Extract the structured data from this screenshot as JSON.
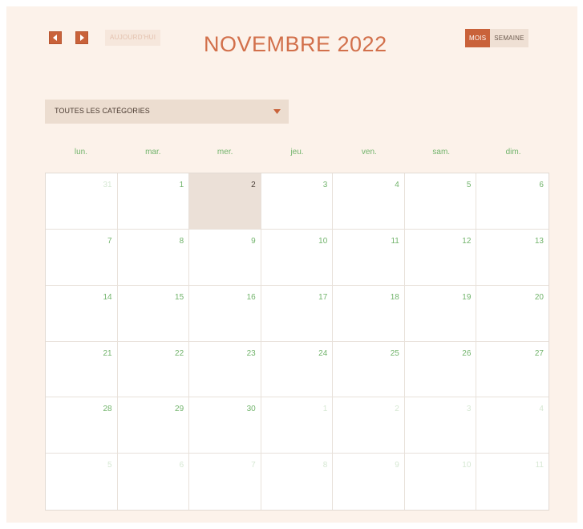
{
  "toolbar": {
    "today_label": "AUJOURD'HUI",
    "title": "NOVEMBRE 2022",
    "views": [
      {
        "label": "MOIS",
        "active": true
      },
      {
        "label": "SEMAINE",
        "active": false
      }
    ]
  },
  "filter": {
    "category_label": "TOUTES LES CATÉGORIES"
  },
  "weekdays": [
    "lun.",
    "mar.",
    "mer.",
    "jeu.",
    "ven.",
    "sam.",
    "dim."
  ],
  "weeks": [
    [
      {
        "day": "31",
        "other": true
      },
      {
        "day": "1"
      },
      {
        "day": "2",
        "today": true
      },
      {
        "day": "3"
      },
      {
        "day": "4"
      },
      {
        "day": "5"
      },
      {
        "day": "6"
      }
    ],
    [
      {
        "day": "7"
      },
      {
        "day": "8"
      },
      {
        "day": "9"
      },
      {
        "day": "10"
      },
      {
        "day": "11"
      },
      {
        "day": "12"
      },
      {
        "day": "13"
      }
    ],
    [
      {
        "day": "14"
      },
      {
        "day": "15"
      },
      {
        "day": "16"
      },
      {
        "day": "17"
      },
      {
        "day": "18"
      },
      {
        "day": "19"
      },
      {
        "day": "20"
      }
    ],
    [
      {
        "day": "21"
      },
      {
        "day": "22"
      },
      {
        "day": "23"
      },
      {
        "day": "24"
      },
      {
        "day": "25"
      },
      {
        "day": "26"
      },
      {
        "day": "27"
      }
    ],
    [
      {
        "day": "28"
      },
      {
        "day": "29"
      },
      {
        "day": "30"
      },
      {
        "day": "1",
        "other": true
      },
      {
        "day": "2",
        "other": true
      },
      {
        "day": "3",
        "other": true
      },
      {
        "day": "4",
        "other": true
      }
    ],
    [
      {
        "day": "5",
        "other": true
      },
      {
        "day": "6",
        "other": true
      },
      {
        "day": "7",
        "other": true
      },
      {
        "day": "8",
        "other": true
      },
      {
        "day": "9",
        "other": true
      },
      {
        "day": "10",
        "other": true
      },
      {
        "day": "11",
        "other": true
      }
    ]
  ],
  "colors": {
    "accent": "#c9623a",
    "title": "#d2704b",
    "day_number": "#72b46c",
    "today_bg": "#ebe0d7",
    "panel_bg": "#fcf2ea"
  },
  "icons": {
    "prev": "triangle-left-icon",
    "next": "triangle-right-icon",
    "caret": "caret-down-icon"
  }
}
